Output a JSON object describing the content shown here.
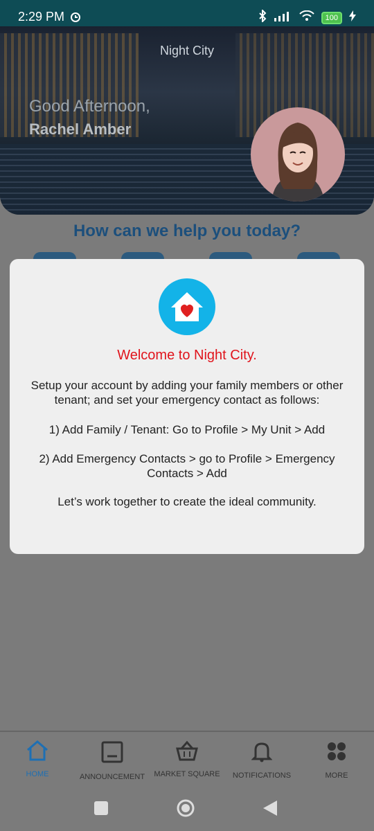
{
  "status_bar": {
    "time": "2:29 PM",
    "battery": "100"
  },
  "hero": {
    "city": "Night City",
    "greeting": "Good Afternoon,",
    "user_name": "Rachel Amber"
  },
  "main": {
    "help_title": "How can we help you today?"
  },
  "modal": {
    "title": "Welcome to Night City.",
    "line1": "Setup your account by adding your family members or other tenant; and set your emergency contact as follows:",
    "line2": "1) Add Family / Tenant: Go to Profile > My Unit > Add",
    "line3": "2) Add Emergency Contacts > go to Profile > Emergency Contacts > Add",
    "line4": "Let’s work together to create the ideal community."
  },
  "bottom_nav": [
    {
      "label": "HOME",
      "icon": "home-icon"
    },
    {
      "label": "ANNOUNCEMENT",
      "icon": "announcement-icon"
    },
    {
      "label": "MARKET SQUARE",
      "icon": "basket-icon"
    },
    {
      "label": "NOTIFICATIONS",
      "icon": "bell-icon"
    },
    {
      "label": "MORE",
      "icon": "grid-dots-icon"
    }
  ],
  "colors": {
    "accent": "#13b3e8",
    "title_red": "#e0141c",
    "active_nav": "#1e6fb3",
    "status_bg": "#0e4c55"
  }
}
